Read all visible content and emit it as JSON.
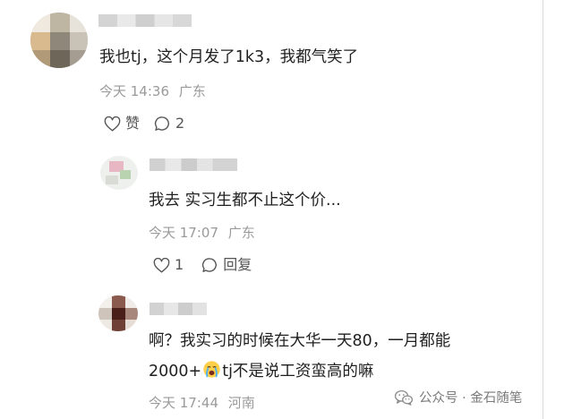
{
  "comments": [
    {
      "text": "我也tj，这个月发了1k3，我都气笑了",
      "time": "今天 14:36",
      "location": "广东",
      "like_label": "赞",
      "reply_count": "2"
    },
    {
      "text": "我去 实习生都不止这个价...",
      "time": "今天 17:07",
      "location": "广东",
      "like_count": "1",
      "reply_label": "回复"
    },
    {
      "text_line1": "啊？我实习的时候在大华一天80，一月都能",
      "text_line2_prefix": "2000+",
      "text_line2_suffix": "tj不是说工资蛮高的嘛",
      "emoji": "crying-face-emoji",
      "time": "今天 17:44",
      "location": "河南"
    }
  ],
  "watermark": {
    "text": "公众号 · 金石随笔",
    "icon": "wechat-icon"
  },
  "colors": {
    "text": "#1f1f1f",
    "meta": "#9a9a9a",
    "action": "#555555"
  }
}
